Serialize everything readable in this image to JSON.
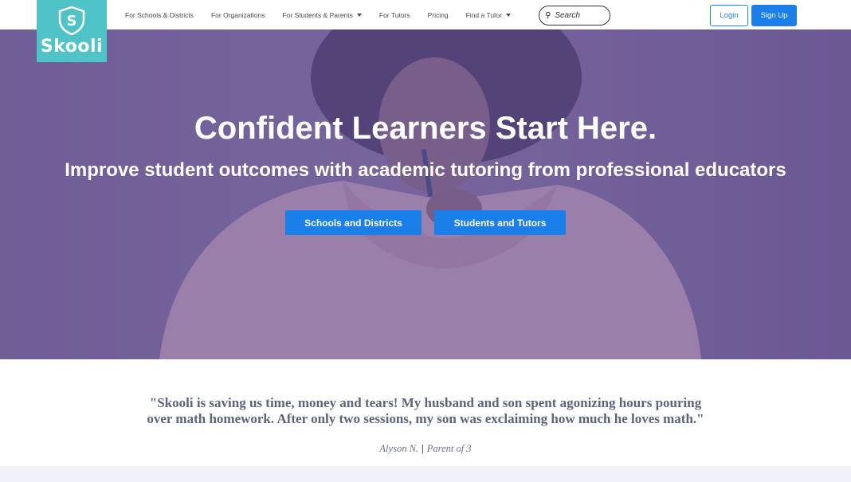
{
  "brand": {
    "name": "Skooli",
    "logo_color": "#4fc3c8",
    "shield_letter": "S"
  },
  "nav": {
    "links": [
      {
        "label": "For Schools & Districts",
        "dropdown": false
      },
      {
        "label": "For Organizations",
        "dropdown": false
      },
      {
        "label": "For Students & Parents",
        "dropdown": true
      },
      {
        "label": "For Tutors",
        "dropdown": false
      },
      {
        "label": "Pricing",
        "dropdown": false
      },
      {
        "label": "Find a Tutor",
        "dropdown": true
      }
    ],
    "search_placeholder": "Search",
    "login_label": "Login",
    "signup_label": "Sign Up"
  },
  "hero": {
    "title": "Confident Learners Start Here.",
    "subtitle": "Improve student outcomes with academic tutoring from professional educators",
    "buttons": [
      "Schools and Districts",
      "Students and Tutors"
    ]
  },
  "testimonial": {
    "quote": "\"Skooli is saving us time, money and tears! My husband and son spent agonizing hours pouring over math homework. After only two sessions, my son was exclaiming how much he loves math.\"",
    "author": "Alyson N.",
    "separator": "|",
    "role": "Parent of 3"
  },
  "colors": {
    "primary_blue": "#1a7fe8",
    "hero_overlay": "#6854a0",
    "teal": "#4fc3c8"
  }
}
